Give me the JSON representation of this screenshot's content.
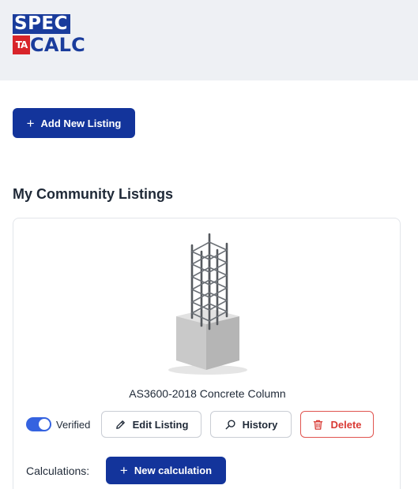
{
  "brand": {
    "logo_top": "SPEC",
    "logo_badge": "TA",
    "logo_bottom": "CALC",
    "colors": {
      "primary": "#13349b",
      "logo_red": "#d8242a",
      "toggle": "#3563e0",
      "danger": "#d93a34"
    }
  },
  "toolbar": {
    "add_label": "Add New Listing",
    "add_icon": "plus-icon"
  },
  "section": {
    "title": "My Community Listings"
  },
  "listing": {
    "image_icon": "rebar-column-image",
    "title": "AS3600-2018 Concrete Column",
    "verified": {
      "label": "Verified",
      "checked": true
    },
    "actions": {
      "edit": {
        "label": "Edit Listing",
        "icon": "pencil-icon"
      },
      "history": {
        "label": "History",
        "icon": "search-icon"
      },
      "delete": {
        "label": "Delete",
        "icon": "trash-icon"
      }
    },
    "calculations": {
      "label": "Calculations:",
      "new_label": "New calculation",
      "new_icon": "plus-icon"
    }
  }
}
